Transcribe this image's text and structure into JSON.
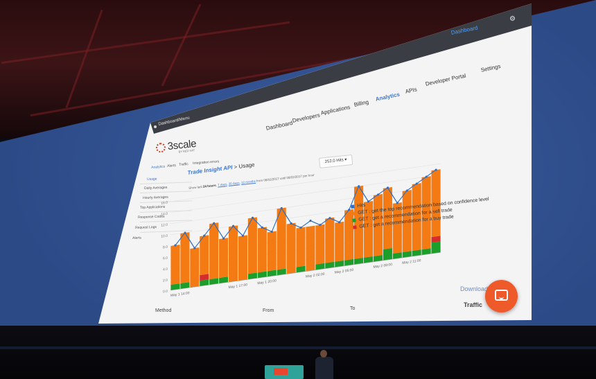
{
  "app": {
    "window_title": "Dashboard/Menu",
    "dashboard_link": "Dashboard",
    "nav": [
      "Dashboard",
      "Developers",
      "Applications",
      "Billing",
      "Analytics",
      "APIs",
      "Developer Portal",
      "Settings"
    ],
    "active_nav": "Analytics"
  },
  "logo": {
    "text": "3scale",
    "sub": "BY RED HAT"
  },
  "subnav": [
    "Analytics",
    "Alerts",
    "Traffic",
    "Integration errors"
  ],
  "sidebar": [
    "Usage",
    "Daily Averages",
    "Hourly Averages",
    "Top Applications",
    "Response Codes",
    "Request Logs",
    "Alerts"
  ],
  "header": {
    "api_name": "Trade Insight API",
    "separator": " > ",
    "page": "Usage",
    "period_prefix": "Show last",
    "period_selected": "24 hours",
    "period_options": [
      "7 days",
      "30 days",
      "12 months"
    ],
    "period_range": "from 08/02/2017 until 08/02/2017 per hour",
    "metric_button": "252.0 Hits"
  },
  "chart_data": {
    "type": "bar",
    "stacked": true,
    "with_line": true,
    "categories": [
      "May 1 14:00",
      "",
      "",
      "",
      "",
      "",
      "May 1 17:00",
      "",
      "",
      "May 1 20:00",
      "",
      "",
      "",
      "",
      "May 2 02:00",
      "",
      "",
      "May 2 05:00",
      "",
      "",
      "",
      "May 2 08:00",
      "",
      "",
      "May 2 11:00",
      "",
      "",
      ""
    ],
    "tick_labels": [
      "May 1 14:00",
      "May 1 17:00",
      "May 1 20:00",
      "May 2 02:00",
      "May 2 05:00",
      "May 2 08:00",
      "May 2 11:00"
    ],
    "y_ticks": [
      "0.0",
      "2.0",
      "4.0",
      "6.0",
      "8.0",
      "10.0",
      "12.0",
      "14.0",
      "16.0"
    ],
    "ylim": [
      0,
      16
    ],
    "series": [
      {
        "name": "Hits",
        "color": "#2f6fc4",
        "values": [
          8,
          10,
          7,
          9,
          11,
          8,
          10,
          8,
          11,
          9,
          8,
          12,
          9,
          8,
          9,
          8,
          9,
          8,
          10,
          14,
          11,
          12,
          13,
          10,
          12,
          13,
          14,
          15
        ]
      },
      {
        "name": "GET : get the top recommendation based on confidence level",
        "color": "#f47b14",
        "values": [
          7,
          9,
          7,
          7,
          10,
          7,
          10,
          8,
          10,
          8,
          7,
          11,
          9,
          7,
          8,
          7,
          8,
          7,
          9,
          13,
          10,
          11,
          11,
          9,
          11,
          12,
          13,
          12
        ]
      },
      {
        "name": "GET : get a recommendation for a sell trade",
        "color": "#1c9e2a",
        "values": [
          1,
          1,
          0,
          1,
          1,
          1,
          0,
          0,
          1,
          1,
          1,
          1,
          0,
          1,
          0,
          1,
          1,
          1,
          1,
          1,
          1,
          1,
          2,
          1,
          1,
          1,
          1,
          2
        ]
      },
      {
        "name": "GET : get a recommendation for a buy trade",
        "color": "#d72c2c",
        "values": [
          0,
          0,
          0,
          1,
          0,
          0,
          0,
          0,
          0,
          0,
          0,
          0,
          0,
          0,
          0,
          0,
          0,
          0,
          0,
          0,
          0,
          0,
          0,
          0,
          0,
          0,
          0,
          1
        ]
      }
    ]
  },
  "bottom": {
    "download": "Download",
    "columns": [
      "Method",
      "From",
      "To",
      "Traffic"
    ]
  }
}
